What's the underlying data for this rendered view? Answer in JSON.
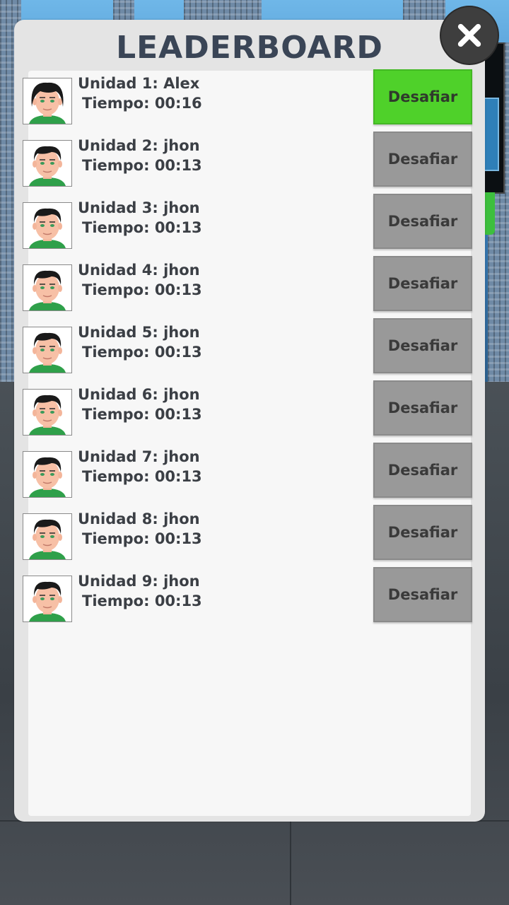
{
  "title": "LEADERBOARD",
  "colors": {
    "active_button": "#4fd12a",
    "inactive_button": "#999999",
    "title": "#3a4556"
  },
  "close_icon": "close-icon",
  "entries": [
    {
      "name": "Unidad 1: Alex",
      "time": "Tiempo: 00:16",
      "button": "Desafiar",
      "active": true
    },
    {
      "name": "Unidad 2: jhon",
      "time": "Tiempo: 00:13",
      "button": "Desafiar",
      "active": false
    },
    {
      "name": "Unidad 3: jhon",
      "time": "Tiempo: 00:13",
      "button": "Desafiar",
      "active": false
    },
    {
      "name": "Unidad 4: jhon",
      "time": "Tiempo: 00:13",
      "button": "Desafiar",
      "active": false
    },
    {
      "name": "Unidad 5: jhon",
      "time": "Tiempo: 00:13",
      "button": "Desafiar",
      "active": false
    },
    {
      "name": "Unidad 6: jhon",
      "time": "Tiempo: 00:13",
      "button": "Desafiar",
      "active": false
    },
    {
      "name": "Unidad 7: jhon",
      "time": "Tiempo: 00:13",
      "button": "Desafiar",
      "active": false
    },
    {
      "name": "Unidad 8: jhon",
      "time": "Tiempo: 00:13",
      "button": "Desafiar",
      "active": false
    },
    {
      "name": "Unidad 9: jhon",
      "time": "Tiempo: 00:13",
      "button": "Desafiar",
      "active": false
    }
  ]
}
